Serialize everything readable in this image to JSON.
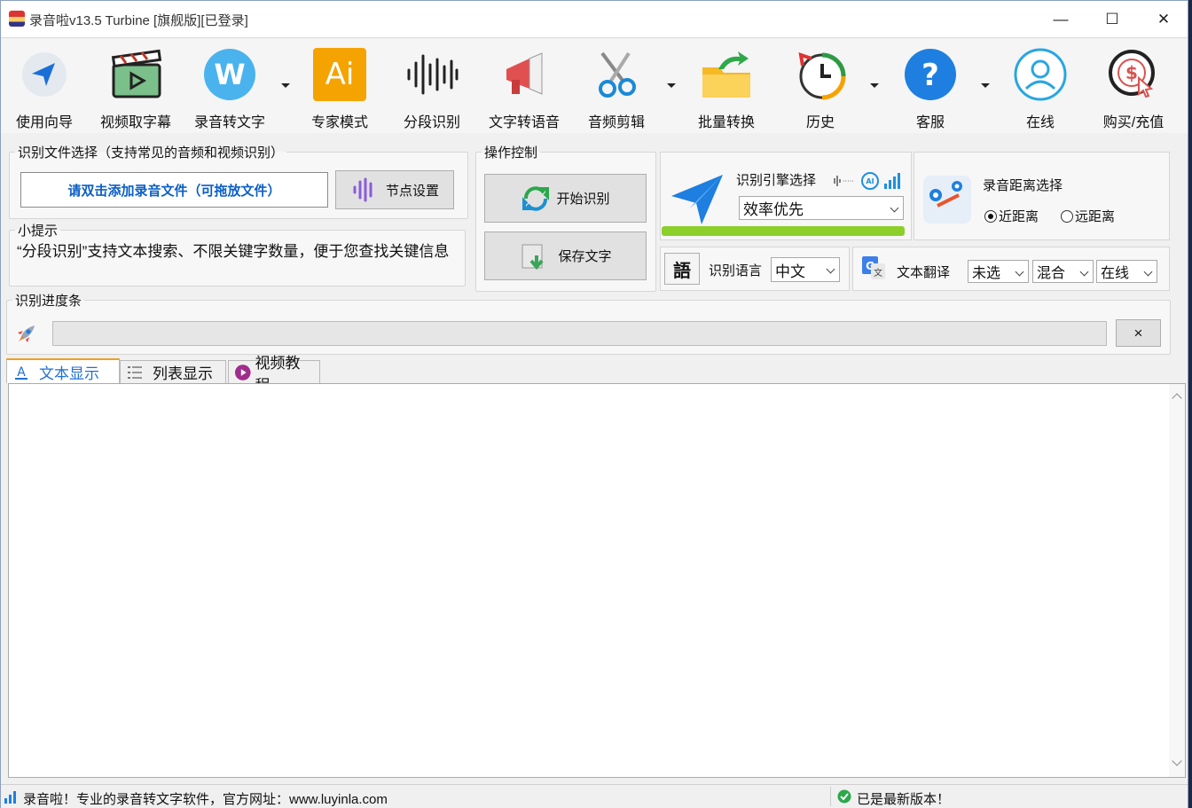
{
  "window": {
    "title": "录音啦v13.5 Turbine [旗舰版][已登录]",
    "minimize": "—",
    "maximize": "☐",
    "close": "✕"
  },
  "toolbar": {
    "items": [
      {
        "label": "使用向导"
      },
      {
        "label": "视频取字幕"
      },
      {
        "label": "录音转文字"
      },
      {
        "label": "专家模式",
        "icon_text": "Ai"
      },
      {
        "label": "分段识别"
      },
      {
        "label": "文字转语音"
      },
      {
        "label": "音频剪辑"
      },
      {
        "label": "批量转换"
      },
      {
        "label": "历史"
      },
      {
        "label": "客服"
      },
      {
        "label": "在线"
      },
      {
        "label": "购买/充值"
      }
    ]
  },
  "file_select": {
    "legend": "识别文件选择（支持常见的音频和视频识别）",
    "add_file_label": "请双击添加录音文件（可拖放文件）",
    "node_settings_label": "节点设置"
  },
  "tips": {
    "legend": "小提示",
    "text": "“分段识别”支持文本搜索、不限关键字数量，便于您查找关键信息"
  },
  "controls": {
    "legend": "操作控制",
    "start_label": "开始识别",
    "save_label": "保存文字"
  },
  "engine": {
    "label": "识别引擎选择",
    "selected": "效率优先"
  },
  "distance": {
    "label": "录音距离选择",
    "options": [
      "近距离",
      "远距离"
    ],
    "selected": "近距离"
  },
  "language": {
    "icon_text": "語",
    "label": "识别语言",
    "selected": "中文"
  },
  "translation": {
    "label": "文本翻译",
    "option1": "未选",
    "option2": "混合",
    "option3": "在线"
  },
  "progress": {
    "legend": "识别进度条",
    "value": 0,
    "clear_label": "×"
  },
  "tabs": [
    {
      "label": "文本显示",
      "active": true
    },
    {
      "label": "列表显示",
      "active": false
    },
    {
      "label": "视频教程",
      "active": false
    }
  ],
  "status": {
    "left": "录音啦！专业的录音转文字软件，官方网址：www.luyinla.com",
    "right": "已是最新版本！"
  },
  "colors": {
    "accent_blue": "#1f6fd6",
    "link_blue": "#0b5fc5",
    "green_bar": "#8ccf2a"
  }
}
